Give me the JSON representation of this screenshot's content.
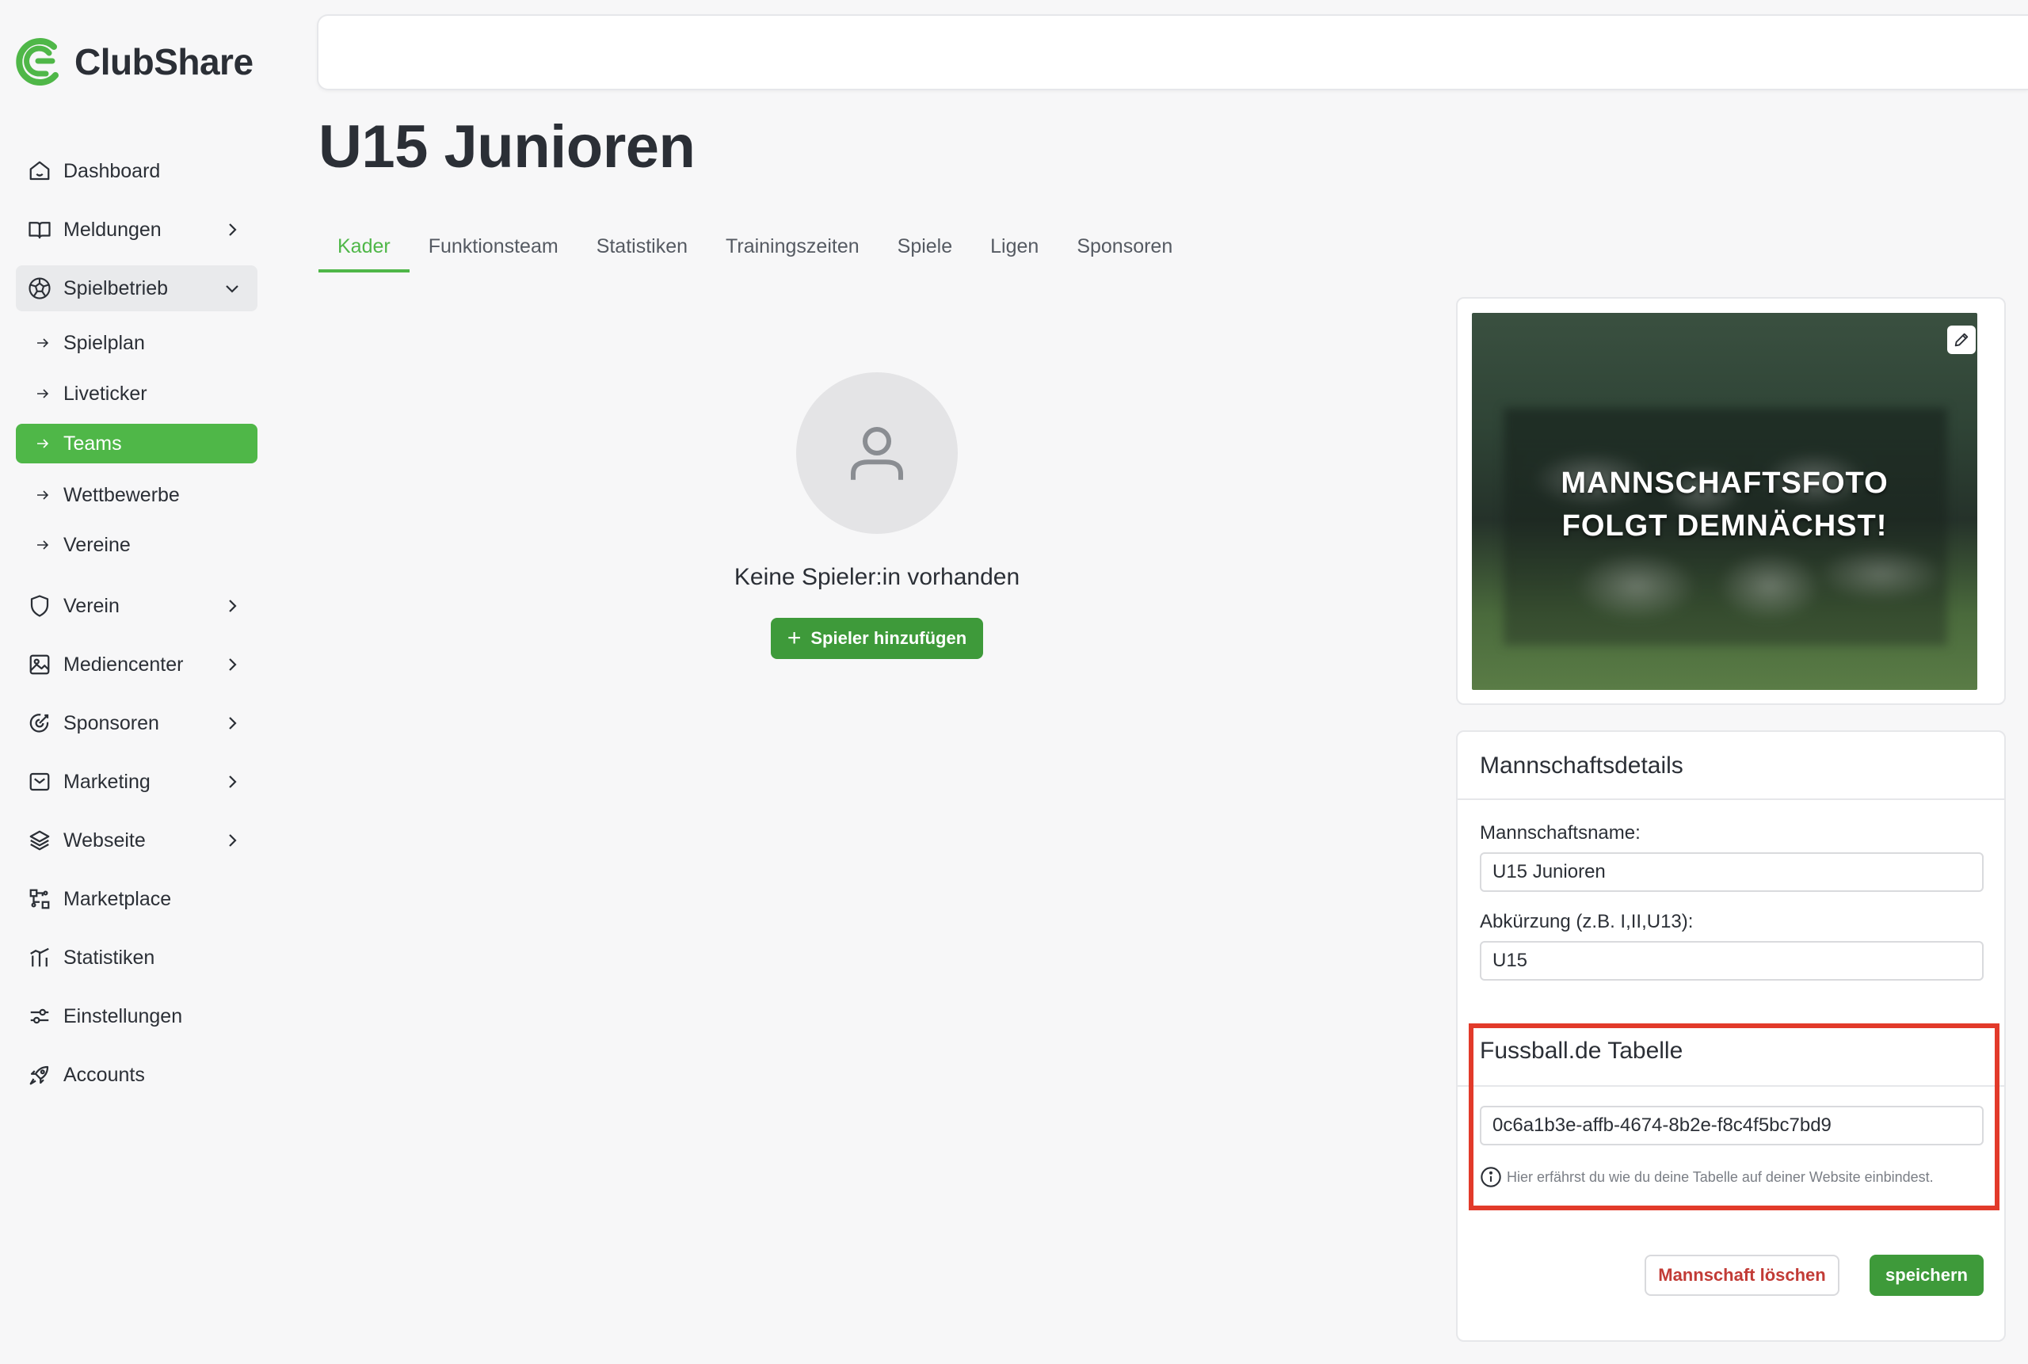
{
  "brand": {
    "name": "ClubShare",
    "accent": "#4fb748"
  },
  "sidebar": {
    "items": [
      {
        "label": "Dashboard",
        "icon": "home-icon"
      },
      {
        "label": "Meldungen",
        "icon": "book-icon"
      },
      {
        "label": "Spielbetrieb",
        "icon": "soccer-ball-icon",
        "expanded": true
      },
      {
        "label": "Verein",
        "icon": "shield-icon"
      },
      {
        "label": "Mediencenter",
        "icon": "image-icon"
      },
      {
        "label": "Sponsoren",
        "icon": "target-icon"
      },
      {
        "label": "Marketing",
        "icon": "mail-icon"
      },
      {
        "label": "Webseite",
        "icon": "layers-icon"
      },
      {
        "label": "Marketplace",
        "icon": "marketplace-icon"
      },
      {
        "label": "Statistiken",
        "icon": "chart-icon"
      },
      {
        "label": "Einstellungen",
        "icon": "sliders-icon"
      },
      {
        "label": "Accounts",
        "icon": "rocket-icon"
      }
    ],
    "subitems": [
      {
        "label": "Spielplan"
      },
      {
        "label": "Liveticker"
      },
      {
        "label": "Teams",
        "active": true
      },
      {
        "label": "Wettbewerbe"
      },
      {
        "label": "Vereine"
      }
    ]
  },
  "page": {
    "title": "U15 Junioren"
  },
  "tabs": [
    {
      "label": "Kader",
      "active": true
    },
    {
      "label": "Funktionsteam"
    },
    {
      "label": "Statistiken"
    },
    {
      "label": "Trainingszeiten"
    },
    {
      "label": "Spiele"
    },
    {
      "label": "Ligen"
    },
    {
      "label": "Sponsoren"
    }
  ],
  "empty_state": {
    "text": "Keine Spieler:in vorhanden",
    "button": "Spieler hinzufügen"
  },
  "photo": {
    "line1": "MANNSCHAFTSFOTO",
    "line2": "FOLGT DEMNÄCHST!"
  },
  "details": {
    "header": "Mannschaftsdetails",
    "name_label": "Mannschaftsname:",
    "name_value": "U15 Junioren",
    "abbr_label": "Abkürzung (z.B. I,II,U13):",
    "abbr_value": "U15",
    "fussball_header": "Fussball.de Tabelle",
    "fussball_value": "0c6a1b3e-affb-4674-8b2e-f8c4f5bc7bd9",
    "hint": "Hier erfährst du wie du deine Tabelle auf deiner Website einbindest.",
    "delete_button": "Mannschaft löschen",
    "save_button": "speichern"
  }
}
